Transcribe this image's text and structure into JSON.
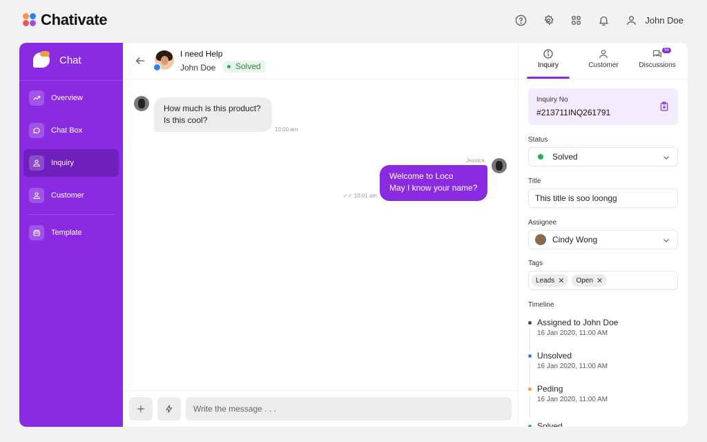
{
  "app": {
    "name": "Chativate"
  },
  "topbar": {
    "icons": [
      "help-icon",
      "gear-icon",
      "grid-icon",
      "bell-icon",
      "user-icon"
    ],
    "user_name": "John Doe"
  },
  "sidebar": {
    "title": "Chat",
    "items": [
      {
        "label": "Overview",
        "icon": "trend-icon"
      },
      {
        "label": "Chat Box",
        "icon": "chat-bubble-icon"
      },
      {
        "label": "Inquiry",
        "icon": "user-icon"
      },
      {
        "label": "Customer",
        "icon": "user-icon"
      },
      {
        "label": "Template",
        "icon": "template-icon"
      }
    ],
    "active": "Inquiry"
  },
  "chat": {
    "title": "I need Help",
    "customer_name": "John Doe",
    "status": "Solved",
    "messages": [
      {
        "direction": "in",
        "lines": [
          "How much is this product?",
          "Is this cool?"
        ],
        "time": "10:00 am"
      },
      {
        "direction": "out",
        "sender": "Jessica",
        "lines": [
          "Welcome to Loco",
          "May I know your name?"
        ],
        "time": "10:01 am"
      }
    ],
    "composer_placeholder": "Write the message . . ."
  },
  "panel": {
    "tabs": [
      {
        "label": "Inquiry",
        "icon": "info-icon"
      },
      {
        "label": "Customer",
        "icon": "user-icon"
      },
      {
        "label": "Discussions",
        "icon": "discussion-icon",
        "badge": "56"
      }
    ],
    "active_tab": "Inquiry",
    "inquiry_no_label": "Inquiry No",
    "inquiry_no": "#213711INQ261791",
    "status_label": "Status",
    "status_value": "Solved",
    "title_label": "Title",
    "title_value": "This title is soo loongg",
    "assignee_label": "Assignee",
    "assignee_value": "Cindy Wong",
    "tags_label": "Tags",
    "tags": [
      "Leads",
      "Open"
    ],
    "timeline_label": "Timeline",
    "timeline": [
      {
        "title": "Assigned to John Doe",
        "date": "16 Jan 2020, 11:00 AM",
        "color": "#444444"
      },
      {
        "title": "Unsolved",
        "date": "16 Jan 2020, 11:00 AM",
        "color": "#2f80ed"
      },
      {
        "title": "Peding",
        "date": "16 Jan 2020, 11:00 AM",
        "color": "#f2994a"
      },
      {
        "title": "Solved",
        "date": "",
        "color": "#27ae60"
      }
    ]
  },
  "colors": {
    "accent": "#8a2be2",
    "success": "#27ae60"
  }
}
